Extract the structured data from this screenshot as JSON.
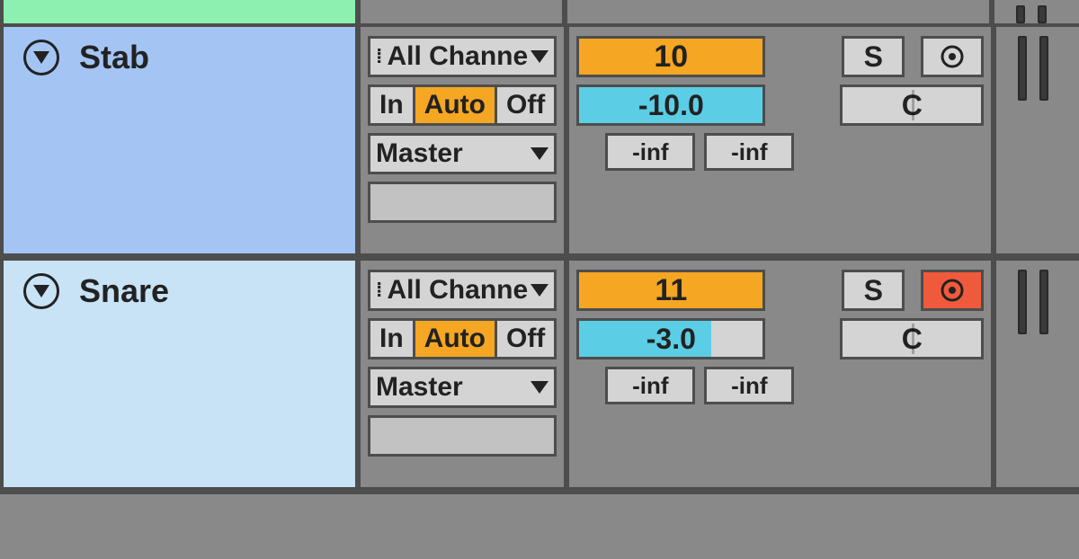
{
  "tracks": [
    {
      "name": "Stab",
      "bg_class": "track-blue-1",
      "input_channel": "All Channe",
      "monitor": {
        "in": "In",
        "auto": "Auto",
        "off": "Off",
        "active": "auto"
      },
      "output": "Master",
      "number": "10",
      "solo_label": "S",
      "armed": false,
      "volume": "-10.0",
      "volume_fill_pct": 100,
      "pan": "C",
      "sends": [
        "-inf",
        "-inf"
      ]
    },
    {
      "name": "Snare",
      "bg_class": "track-blue-2",
      "input_channel": "All Channe",
      "monitor": {
        "in": "In",
        "auto": "Auto",
        "off": "Off",
        "active": "auto"
      },
      "output": "Master",
      "number": "11",
      "solo_label": "S",
      "armed": true,
      "volume": "-3.0",
      "volume_fill_pct": 72,
      "pan": "C",
      "sends": [
        "-inf",
        "-inf"
      ]
    }
  ]
}
